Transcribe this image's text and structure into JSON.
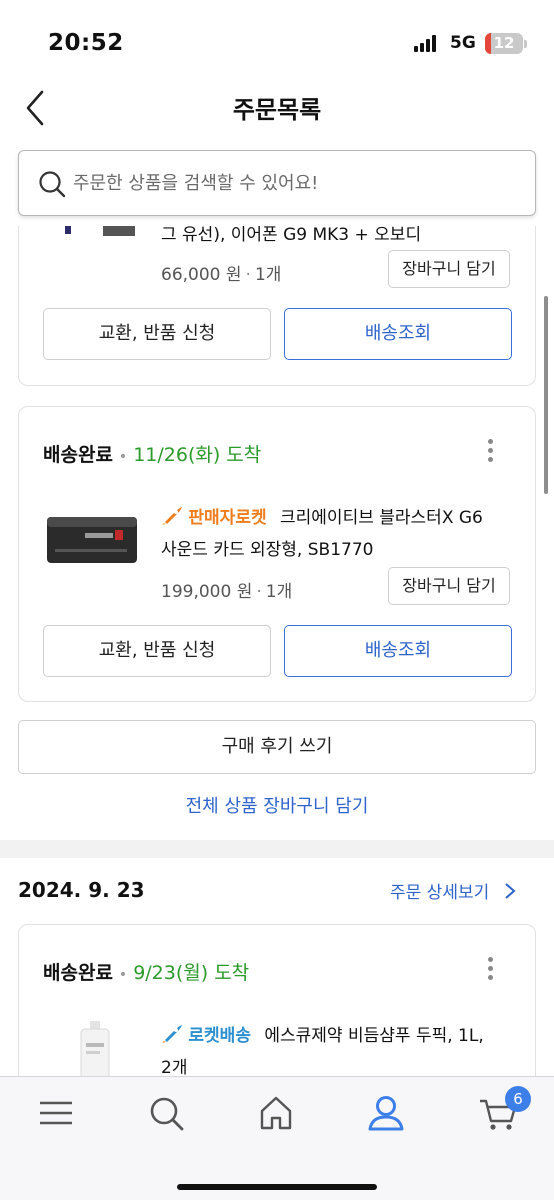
{
  "status_bar": {
    "time": "20:52",
    "network": "5G",
    "battery": "12"
  },
  "header": {
    "title": "주문목록"
  },
  "search": {
    "placeholder": "주문한 상품을 검색할 수 있어요!"
  },
  "order1": {
    "item": {
      "name_partial": "그 유선), 이어폰 G9 MK3 + 오보디",
      "price": "66,000 원",
      "qty": "1개",
      "cart_label": "장바구니 담기"
    },
    "return_label": "교환, 반품 신청",
    "track_label": "배송조회",
    "item2": {
      "status": "배송완료",
      "arrival": "11/26(화) 도착",
      "badge": "판매자로켓",
      "name_line1": "크리에이티브 블라스터X G6",
      "name_line2": "사운드 카드 외장형, SB1770",
      "price": "199,000 원",
      "qty": "1개",
      "cart_label": "장바구니 담기"
    },
    "return_label2": "교환, 반품 신청",
    "track_label2": "배송조회",
    "review_label": "구매 후기 쓰기",
    "all_cart_label": "전체 상품 장바구니 담기"
  },
  "order2": {
    "date": "2024. 9. 23",
    "detail_label": "주문 상세보기",
    "item": {
      "status": "배송완료",
      "arrival": "9/23(월) 도착",
      "badge": "로켓배송",
      "name_line1": "에스큐제약 비듬샴푸 두픽, 1L,",
      "name_line2": "2개"
    }
  },
  "bottom_nav": {
    "items": [
      "menu-icon",
      "search-icon",
      "home-icon",
      "user-icon",
      "cart-icon"
    ],
    "cart_count": "6",
    "active_color": "#3d7fe8"
  },
  "colors": {
    "accent": "#2f64cc",
    "arrival_green": "#2b9a2b",
    "seller_orange": "#f07c1b"
  }
}
